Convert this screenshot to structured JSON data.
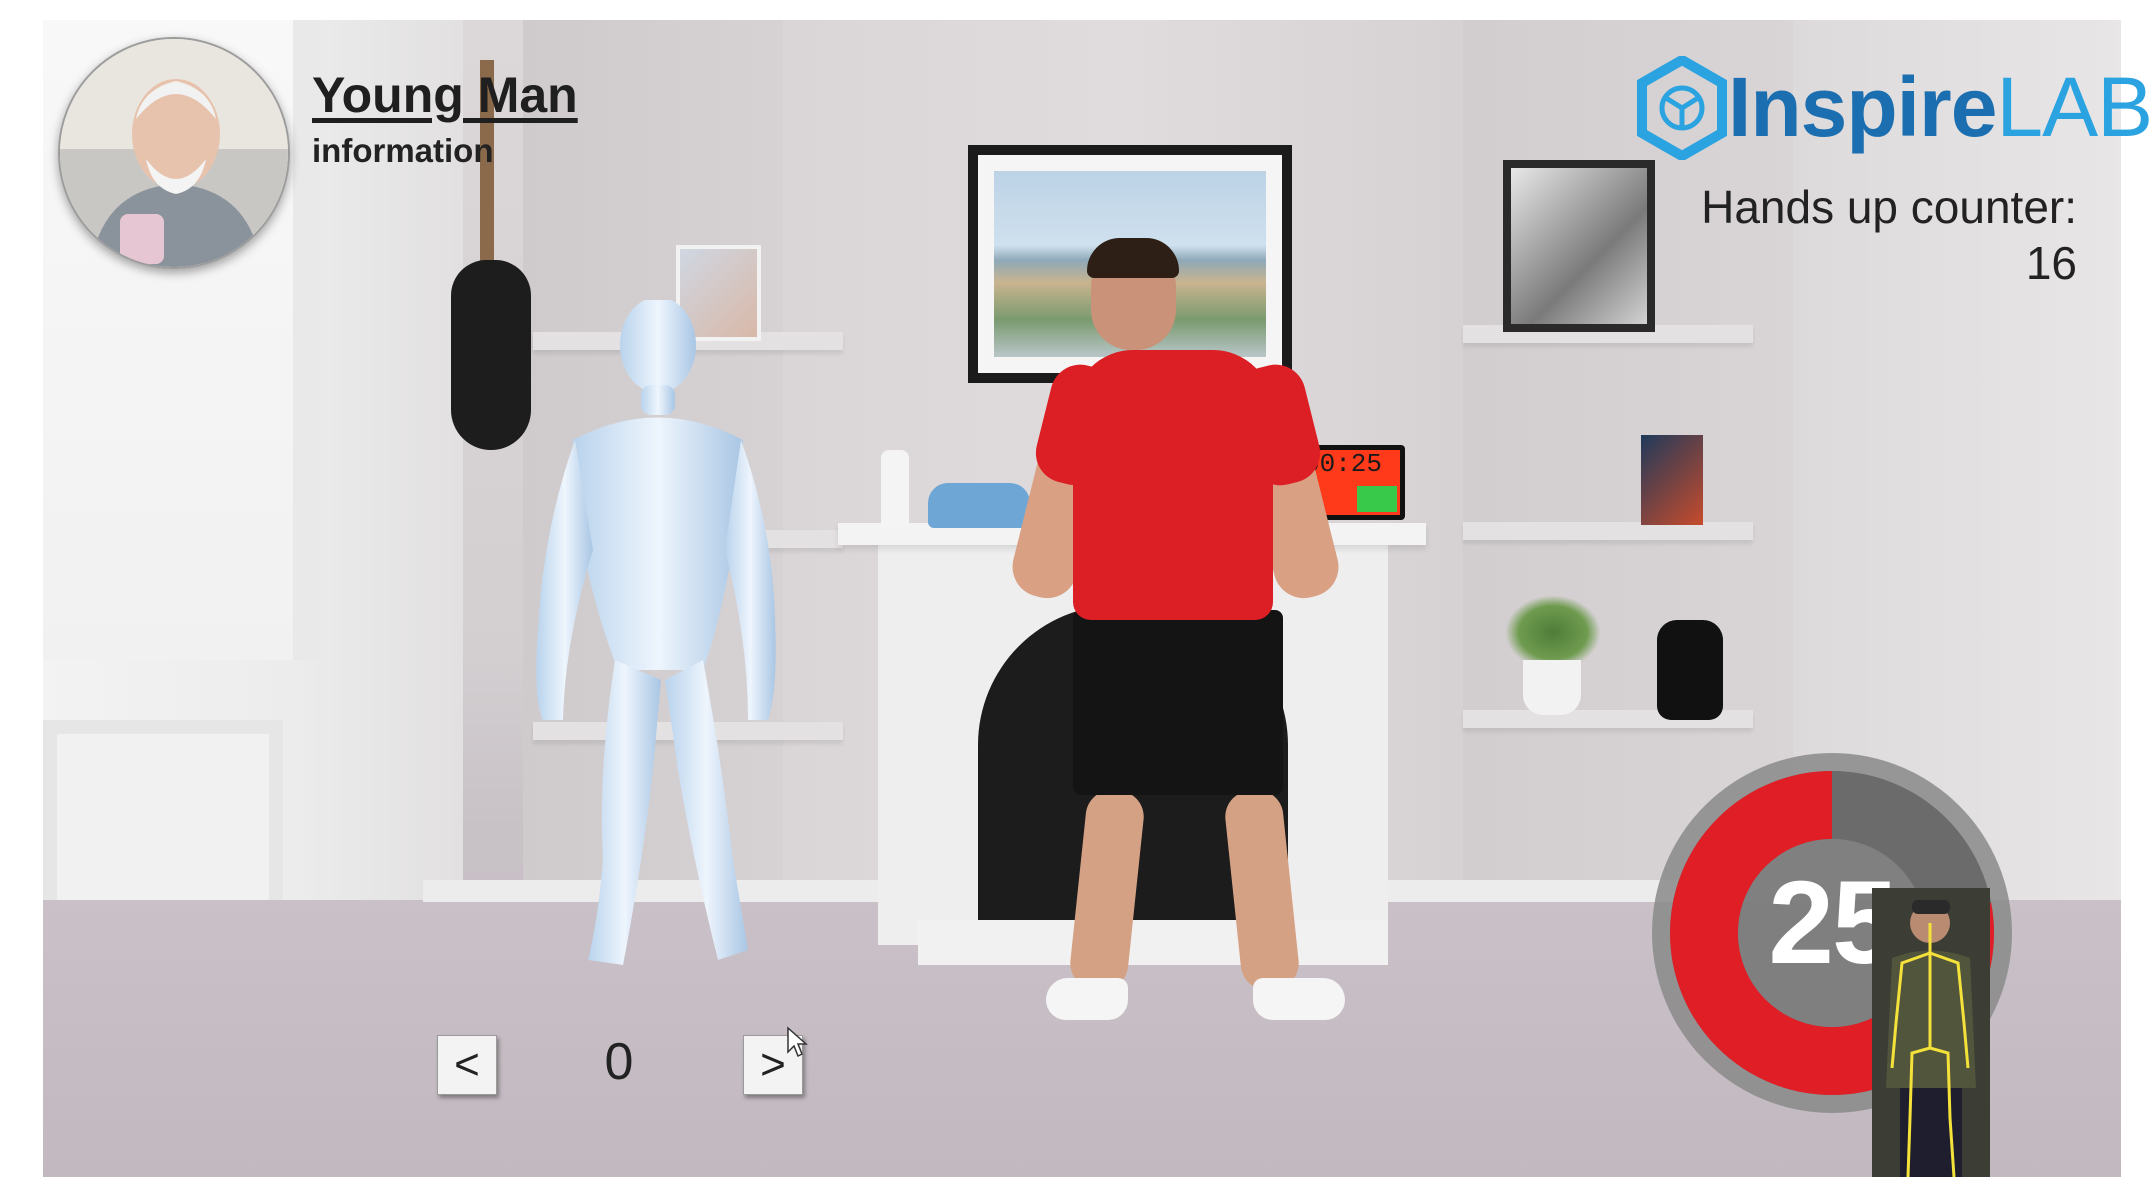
{
  "profile": {
    "name": "Young Man",
    "subtitle": "information"
  },
  "brand": {
    "name_part1": "Inspire",
    "name_part2": "LAB",
    "icon": "hexagon-logo-icon",
    "color_primary": "#1b6fb0",
    "color_secondary": "#2aa3e0"
  },
  "counter": {
    "label": "Hands up counter:",
    "value": "16"
  },
  "video": {
    "clock_text": "00:25"
  },
  "pose_nav": {
    "prev_label": "<",
    "next_label": ">",
    "index": "0"
  },
  "timer": {
    "value": "25",
    "progress": 0.78,
    "ring_color": "#e01e26",
    "track_color": "#6b6b6b"
  }
}
